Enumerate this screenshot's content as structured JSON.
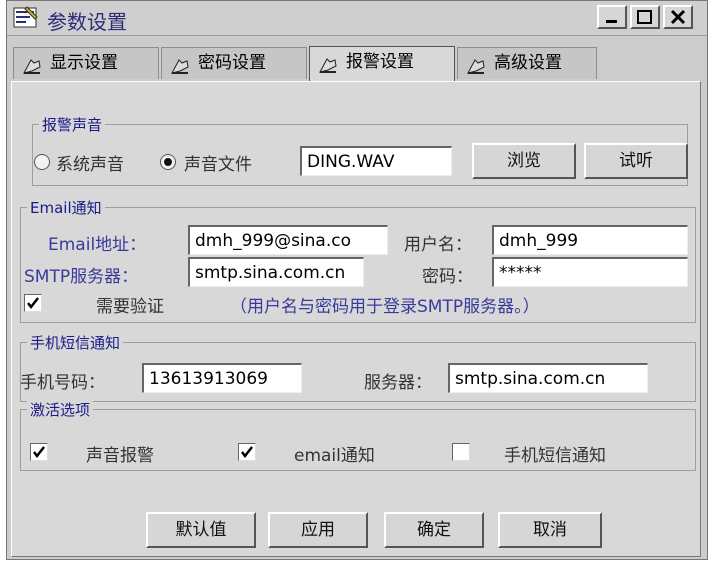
{
  "window": {
    "title": "参数设置"
  },
  "tabs": [
    {
      "label": "显示设置",
      "active": false
    },
    {
      "label": "密码设置",
      "active": false
    },
    {
      "label": "报警设置",
      "active": true
    },
    {
      "label": "高级设置",
      "active": false
    }
  ],
  "alarm_sound": {
    "title": "报警声音",
    "system_sound_label": "系统声音",
    "sound_file_label": "声音文件",
    "selected": "sound_file",
    "file_value": "DING.WAV",
    "browse_label": "浏览",
    "listen_label": "试听"
  },
  "email": {
    "title": "Email通知",
    "address_label": "Email地址：",
    "address_value": "dmh_999@sina.co",
    "username_label": "用户名：",
    "username_value": "dmh_999",
    "smtp_label": "SMTP服务器：",
    "smtp_value": "smtp.sina.com.cn",
    "password_label": "密码：",
    "password_value": "*****",
    "auth_label": "需要验证",
    "auth_checked": true,
    "note": "（用户名与密码用于登录SMTP服务器。）"
  },
  "sms": {
    "title": "手机短信通知",
    "phone_label": "手机号码：",
    "phone_value": "13613913069",
    "server_label": "服务器：",
    "server_value": "smtp.sina.com.cn"
  },
  "activation": {
    "title": "激活选项",
    "options": [
      {
        "label": "声音报警",
        "checked": true
      },
      {
        "label": "email通知",
        "checked": true
      },
      {
        "label": "手机短信通知",
        "checked": false
      }
    ]
  },
  "buttons": {
    "default_label": "默认值",
    "apply_label": "应用",
    "ok_label": "确定",
    "cancel_label": "取消"
  },
  "colors": {
    "title_text": "#2b2e7a",
    "group_title": "#1a1a8a",
    "label_blue": "#3a3a9a"
  },
  "icons": {
    "app": "settings-edit-icon",
    "tab": "tab-hand-icon"
  }
}
